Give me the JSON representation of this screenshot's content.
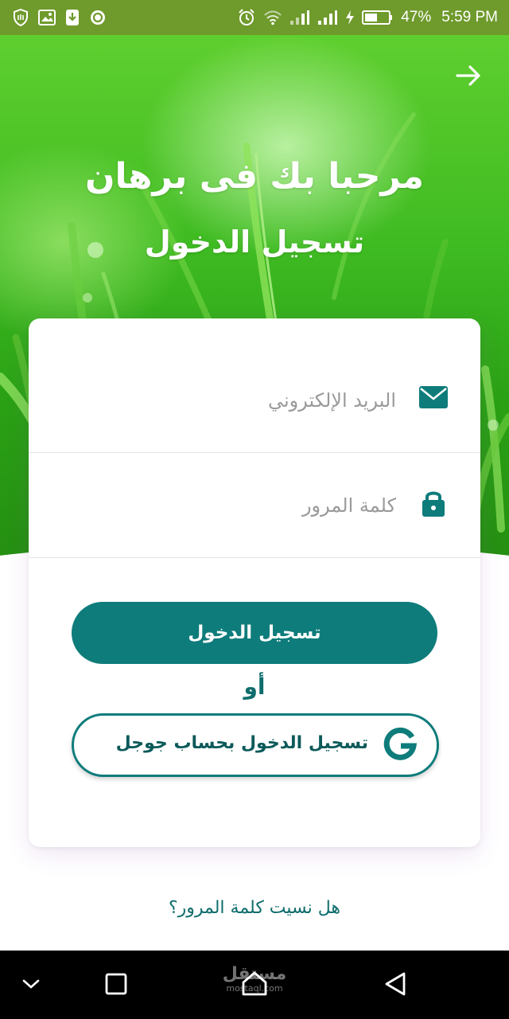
{
  "status_bar": {
    "battery_percent": "47%",
    "time": "5:59 PM"
  },
  "hero": {
    "title": "مرحبا بك فى برهان",
    "subtitle": "تسجيل الدخول"
  },
  "form": {
    "email_placeholder": "البريد الإلكتروني",
    "password_placeholder": "كلمة المرور",
    "login_button": "تسجيل الدخول",
    "or_text": "أو",
    "google_button": "تسجيل الدخول بحساب جوجل"
  },
  "forgot_password": "هل نسيت كلمة المرور؟",
  "watermark": {
    "main": "مستقل",
    "sub": "mostaql.com"
  },
  "colors": {
    "primary": "#0e7c7b",
    "status_bar": "#6f9a2c",
    "hero_green": "#3fbb22"
  }
}
